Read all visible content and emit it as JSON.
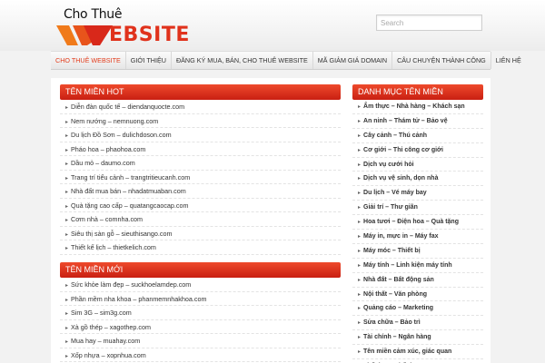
{
  "logo": {
    "top_text": "Cho Thuê",
    "word": "EBSITE"
  },
  "search": {
    "placeholder": "Search"
  },
  "nav": [
    "CHO THUÊ WEBSITE",
    "GIỚI THIỆU",
    "ĐĂNG KÝ MUA, BÁN, CHO THUÊ WEBSITE",
    "MÃ GIẢM GIÁ DOMAIN",
    "CÂU CHUYỆN THÀNH CÔNG",
    "LIÊN HỆ"
  ],
  "hot": {
    "title": "TÊN MIỀN HOT",
    "items": [
      "Diễn đàn quốc tế – diendanquocte.com",
      "Nem nướng – nemnuong.com",
      "Du lịch Đồ Sơn – dulichdoson.com",
      "Pháo hoa – phaohoa.com",
      "Dầu mỏ – daumo.com",
      "Trang trí tiểu cảnh – trangtritieucanh.com",
      "Nhà đất mua bán – nhadatmuaban.com",
      "Quà tặng cao cấp – quatangcaocap.com",
      "Cơm nhà – comnha.com",
      "Siêu thị sàn gỗ – sieuthisango.com",
      "Thiết kế lịch – thietkelich.com"
    ]
  },
  "new": {
    "title": "TÊN MIỀN MỚI",
    "items": [
      "Sức khỏe làm đẹp – suckhoelamdep.com",
      "Phần mềm nha khoa – phanmemnhakhoa.com",
      "Sim 3G – sim3g.com",
      "Xà gồ thép – xagothep.com",
      "Mua hay – muahay.com",
      "Xốp nhựa – xopnhua.com"
    ]
  },
  "categories": {
    "title": "DANH MỤC TÊN MIỀN",
    "items": [
      "Ẩm thực – Nhà hàng – Khách sạn",
      "An ninh – Thám tử – Bảo vệ",
      "Cây cảnh – Thú cảnh",
      "Cơ giới – Thi công cơ giới",
      "Dịch vụ cưới hỏi",
      "Dịch vụ vệ sinh, dọn nhà",
      "Du lịch – Vé máy bay",
      "Giải trí – Thư giãn",
      "Hoa tươi – Điện hoa – Quà tặng",
      "Máy in, mực in – Máy fax",
      "Máy móc – Thiết bị",
      "Máy tính – Linh kiện máy tính",
      "Nhà đất – Bất động sản",
      "Nội thất – Văn phòng",
      "Quảng cáo – Marketing",
      "Sửa chữa – Bảo trì",
      "Tài chính – Ngân hàng",
      "Tên miền cảm xúc, giác quan",
      "Thể dục – Thể thao"
    ]
  }
}
